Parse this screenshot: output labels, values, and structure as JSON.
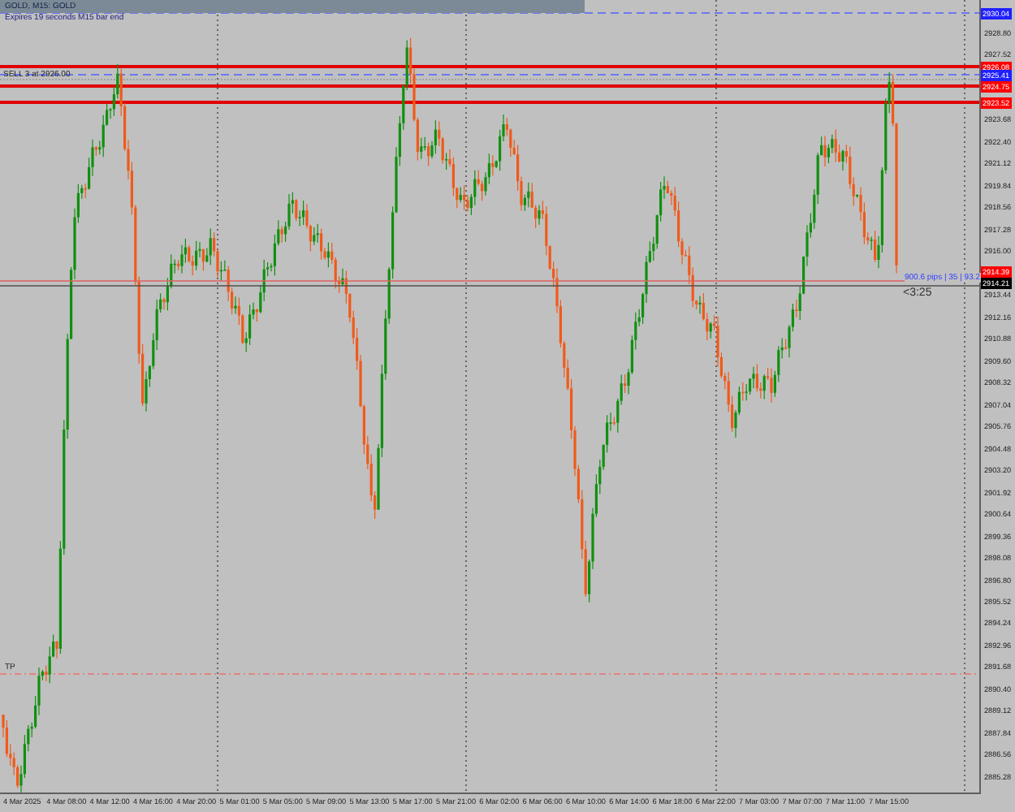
{
  "chart": {
    "title": "GOLD, M15: GOLD",
    "info": "Expires 19 seconds M15 bar end",
    "order_label": "SELL 3 at 2926.00",
    "tp_label": "TP",
    "pips_label": "900.6 pips | 35 | 93.2",
    "timer": "<3:25"
  },
  "price_ticks": [
    "2928.80",
    "2927.52",
    "2923.68",
    "2922.40",
    "2921.12",
    "2919.84",
    "2918.56",
    "2917.28",
    "2916.00",
    "2913.44",
    "2912.16",
    "2910.88",
    "2909.60",
    "2908.32",
    "2907.04",
    "2905.76",
    "2904.48",
    "2903.20",
    "2901.92",
    "2900.64",
    "2899.36",
    "2898.08",
    "2896.80",
    "2895.52",
    "2894.24",
    "2892.96",
    "2891.68",
    "2890.40",
    "2889.12",
    "2887.84",
    "2886.56",
    "2885.28"
  ],
  "price_tags": [
    {
      "text": "2930.04",
      "color": "#2020ff"
    },
    {
      "text": "2926.08",
      "color": "#ff0000"
    },
    {
      "text": "2925.41",
      "color": "#2020ff"
    },
    {
      "text": "2924.75",
      "color": "#ff0000"
    },
    {
      "text": "2923.52",
      "color": "#ff0000"
    },
    {
      "text": "2914.39",
      "color": "#ff0000"
    },
    {
      "text": "2914.21",
      "color": "#000000"
    }
  ],
  "time_labels": [
    "4 Mar 2025",
    "4 Mar 08:00",
    "4 Mar 12:00",
    "4 Mar 16:00",
    "4 Mar 20:00",
    "5 Mar 01:00",
    "5 Mar 05:00",
    "5 Mar 09:00",
    "5 Mar 13:00",
    "5 Mar 17:00",
    "5 Mar 21:00",
    "6 Mar 02:00",
    "6 Mar 06:00",
    "6 Mar 10:00",
    "6 Mar 14:00",
    "6 Mar 18:00",
    "6 Mar 22:00",
    "7 Mar 03:00",
    "7 Mar 07:00",
    "7 Mar 11:00",
    "7 Mar 15:00"
  ]
}
